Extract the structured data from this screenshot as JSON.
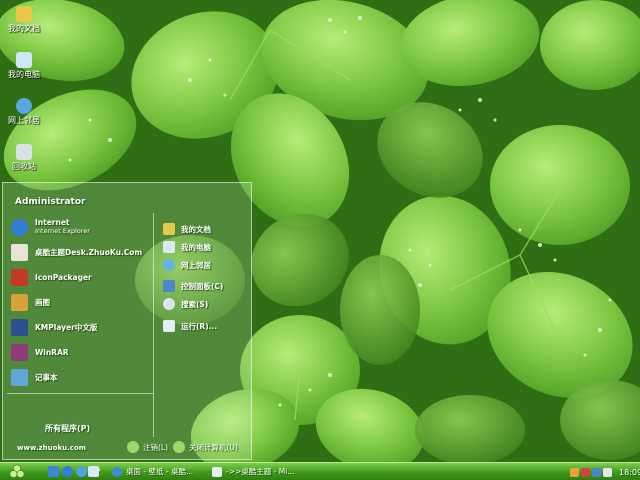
{
  "desktop": {
    "icons": [
      {
        "label": "我的文档",
        "icon": "my-documents-icon",
        "color": "#e8c74b"
      },
      {
        "label": "我的电脑",
        "icon": "my-computer-icon",
        "color": "#cfe6f5"
      },
      {
        "label": "网上邻居",
        "icon": "network-places-icon",
        "color": "#5aa6e0"
      },
      {
        "label": "回收站",
        "icon": "recycle-bin-icon",
        "color": "#d9e2e8"
      }
    ]
  },
  "start_menu": {
    "user": "Administrator",
    "programs": [
      {
        "label": "Internet",
        "sub": "Internet Explorer",
        "icon": "internet-explorer-icon",
        "color": "#2f7fd6"
      },
      {
        "label": "桌酷主题Desk.ZhuoKu.Com",
        "icon": "zhuoku-theme-icon",
        "color": "#e7e3d6"
      },
      {
        "label": "IconPackager",
        "icon": "iconpackager-icon",
        "color": "#c23a24"
      },
      {
        "label": "画图",
        "icon": "paint-icon",
        "color": "#d8a23a"
      },
      {
        "label": "KMPlayer中文版",
        "icon": "kmplayer-icon",
        "color": "#2c4f8f"
      },
      {
        "label": "WinRAR",
        "icon": "winrar-icon",
        "color": "#8e3b7a"
      },
      {
        "label": "记事本",
        "icon": "notepad-icon",
        "color": "#5ea7d8"
      }
    ],
    "all_programs": "所有程序(P)",
    "places": [
      {
        "label": "我的文档",
        "icon": "my-documents-icon",
        "color": "#e8c74b"
      },
      {
        "label": "我的电脑",
        "icon": "my-computer-icon",
        "color": "#d6e9f5"
      },
      {
        "label": "网上邻居",
        "icon": "network-places-icon",
        "color": "#6ab0e3"
      },
      {
        "label": "控制面板(C)",
        "icon": "control-panel-icon",
        "color": "#4a86c9"
      },
      {
        "label": "搜索(S)",
        "icon": "search-icon",
        "color": "#d7e6ef"
      },
      {
        "label": "运行(R)...",
        "icon": "run-icon",
        "color": "#e5eef4"
      }
    ],
    "website": "www.zhuoku.com",
    "logoff_label": "注销(L)",
    "shutdown_label": "关闭计算机(U)"
  },
  "taskbar": {
    "quick_launch": [
      {
        "icon": "show-desktop-icon",
        "color": "#3e86d8"
      },
      {
        "icon": "internet-explorer-icon",
        "color": "#2f7fd6"
      },
      {
        "icon": "media-player-icon",
        "color": "#4fa3e0"
      },
      {
        "icon": "my-computer-icon",
        "color": "#d6e9f5"
      }
    ],
    "quick_launch_more": "»",
    "tasks": [
      {
        "label": "桌面 - 壁纸 - 桌酷...",
        "icon": "browser-icon",
        "color": "#3d8cd8"
      },
      {
        "label": "->>桌酷主题 - Mi...",
        "icon": "document-icon",
        "color": "#e6eef5"
      }
    ],
    "clock": "18:09"
  },
  "colors": {
    "accent": "#3f9a1a",
    "leaf": "#7ec742"
  }
}
